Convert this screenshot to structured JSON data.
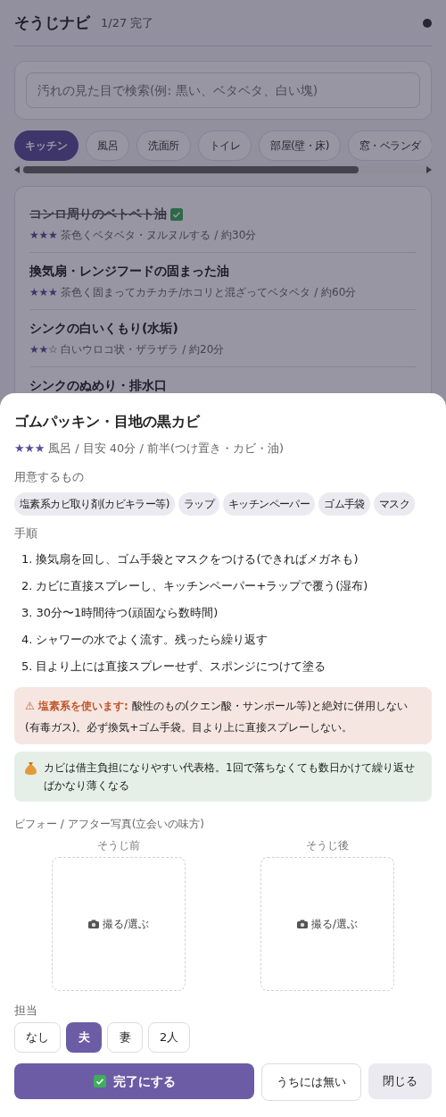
{
  "header": {
    "title": "そうじナビ",
    "progress": "1/27 完了"
  },
  "search": {
    "placeholder": "汚れの見た目で検索(例: 黒い、ベタベタ、白い塊)"
  },
  "tabs": [
    {
      "label": "キッチン",
      "selected": true
    },
    {
      "label": "風呂",
      "selected": false
    },
    {
      "label": "洗面所",
      "selected": false
    },
    {
      "label": "トイレ",
      "selected": false
    },
    {
      "label": "部屋(壁・床)",
      "selected": false
    },
    {
      "label": "窓・ベランダ",
      "selected": false
    }
  ],
  "tasks": [
    {
      "title": "コンロ周りのベトベト油",
      "done": true,
      "stars": 3,
      "detail": "茶色くベタベタ・ヌルヌルする / 約30分"
    },
    {
      "title": "換気扇・レンジフードの固まった油",
      "done": false,
      "stars": 3,
      "detail": "茶色く固まってカチカチ/ホコリと混ざってベタベタ / 約60分"
    },
    {
      "title": "シンクの白いくもり(水垢)",
      "done": false,
      "stars": 2,
      "detail": "白いウロコ状・ザラザラ / 約20分"
    },
    {
      "title": "シンクのぬめり・排水口"
    }
  ],
  "sheet": {
    "title": "ゴムパッキン・目地の黒カビ",
    "stars": 3,
    "meta": "風呂 / 目安 40分 / 前半(つけ置き・カビ・油)",
    "supplies_label": "用意するもの",
    "supplies": [
      "塩素系カビ取り剤(カビキラー等)",
      "ラップ",
      "キッチンペーパー",
      "ゴム手袋",
      "マスク"
    ],
    "steps_label": "手順",
    "steps": [
      {
        "number": "1.",
        "text": "換気扇を回し、ゴム手袋とマスクをつける(できればメガネも)"
      },
      {
        "number": "2.",
        "text": "カビに直接スプレーし、キッチンペーパー+ラップで覆う(湿布)"
      },
      {
        "number": "3.",
        "text": "30分〜1時間待つ(頑固なら数時間)"
      },
      {
        "number": "4.",
        "text": "シャワーの水でよく流す。残ったら繰り返す"
      },
      {
        "number": "5.",
        "text": "目より上には直接スプレーせず、スポンジにつけて塗る"
      }
    ],
    "warning": "**⚠ 塩素系を使います:** 酸性のもの(クエン酸・サンポール等)と絶対に併用しない(有毒ガス)。必ず換気+ゴム手袋。目より上に直接スプレーしない。",
    "tip": "カビは借主負担になりやすい代表格。1回で落ちなくても数日かけて繰り返せばかなり薄くなる",
    "photos_label": "ビフォー / アフター写真(立会いの味方)",
    "photos": [
      {
        "caption": "そうじ前",
        "action": "撮る/選ぶ"
      },
      {
        "caption": "そうじ後",
        "action": "撮る/選ぶ"
      }
    ],
    "assignee_label": "担当",
    "assignees": [
      {
        "label": "なし",
        "selected": false
      },
      {
        "label": "夫",
        "selected": true
      },
      {
        "label": "妻",
        "selected": false
      },
      {
        "label": "2人",
        "selected": false
      }
    ],
    "actions": [
      {
        "kind": "primary",
        "label": "完了にする"
      },
      {
        "kind": "outline",
        "label": "うちには無い"
      },
      {
        "kind": "plain",
        "label": "閉じる"
      }
    ]
  }
}
